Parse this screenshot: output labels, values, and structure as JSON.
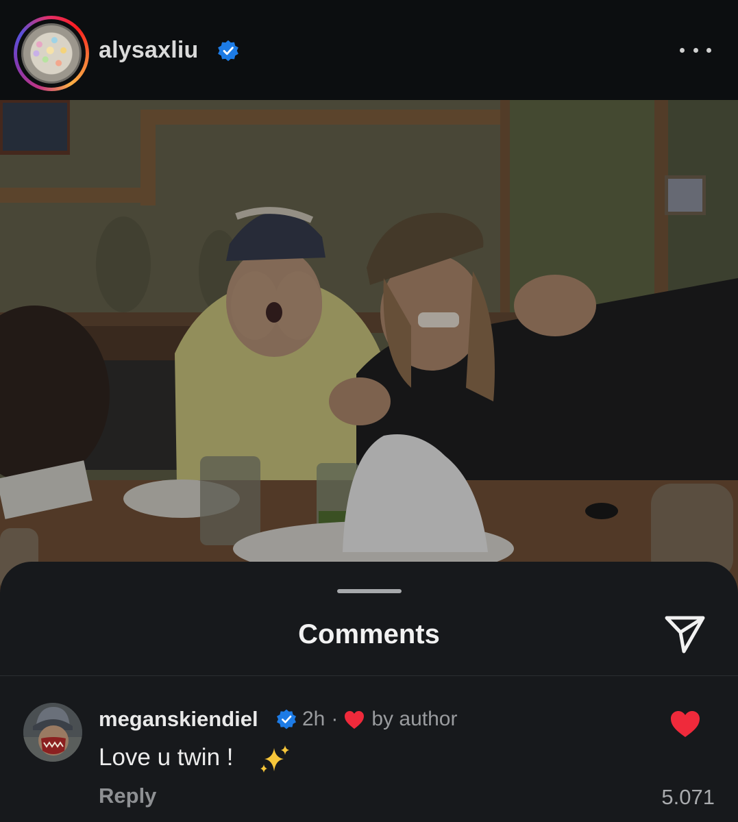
{
  "post": {
    "username": "alysaxliu",
    "verified": true,
    "avatar_icon": "candy-bowl-avatar",
    "more_icon": "more-horizontal-icon"
  },
  "comments_sheet": {
    "title": "Comments",
    "share_icon": "send-icon"
  },
  "comments": [
    {
      "username": "meganskiendiel",
      "verified": true,
      "time": "2h",
      "separator": "·",
      "liked_by_author_label": "by author",
      "text": "Love u twin ! ",
      "emoji": "sparkles",
      "reply_label": "Reply",
      "like_count": "5.071",
      "liked": true
    }
  ],
  "colors": {
    "verified_blue": "#1d7be5",
    "like_red": "#ef2a3b",
    "sheet_bg": "#17191c",
    "header_bg": "#0c0e10"
  }
}
